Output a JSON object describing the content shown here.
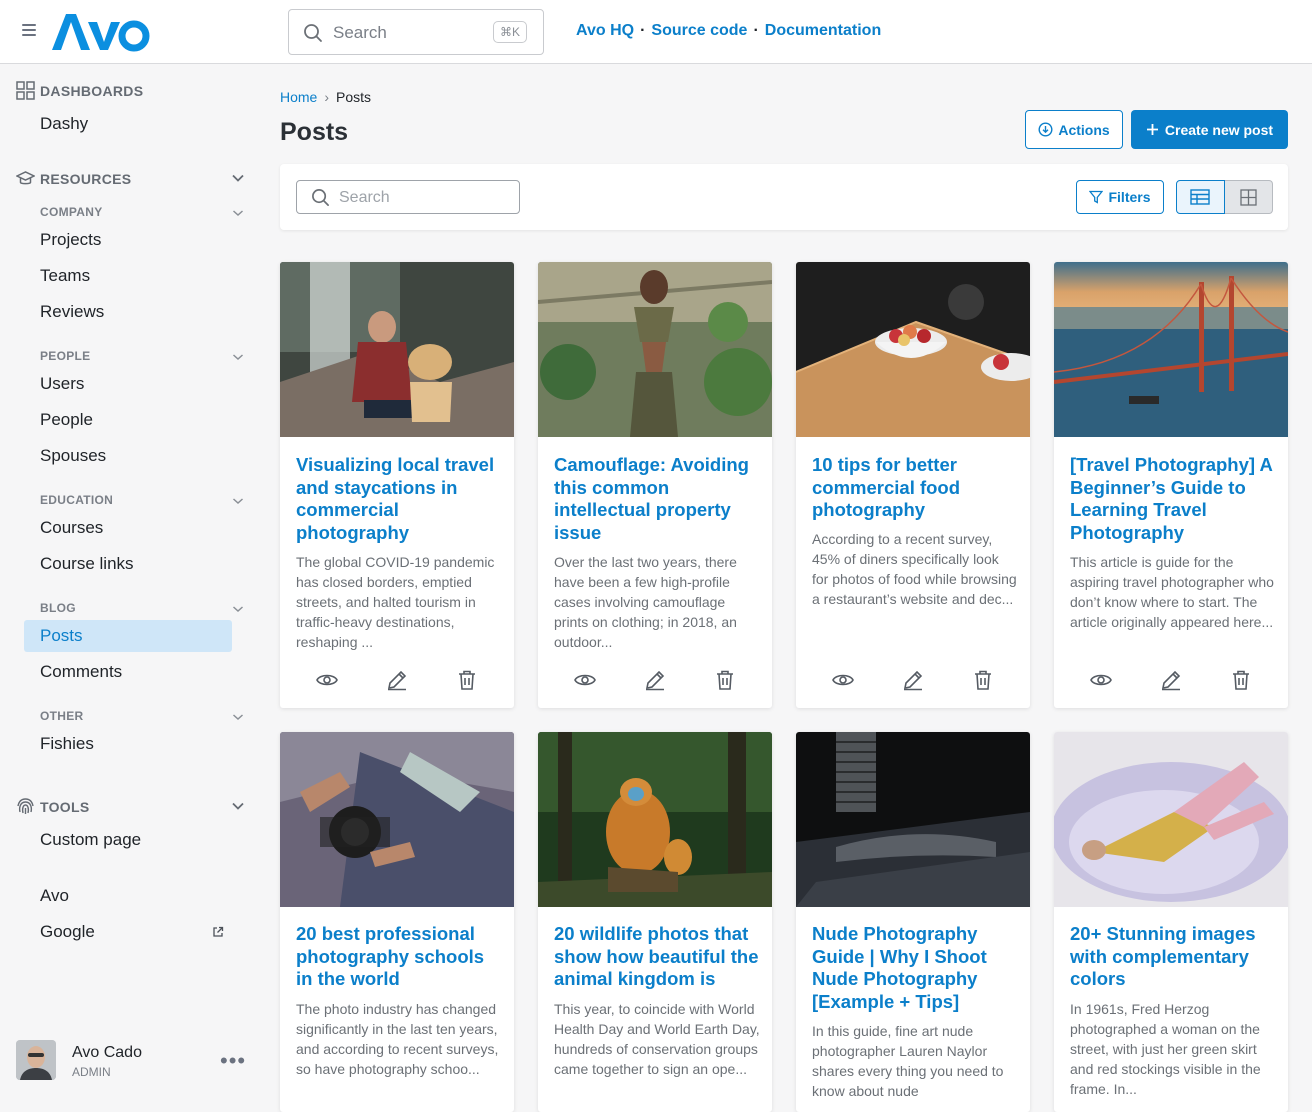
{
  "app": {
    "brand": "Avo"
  },
  "top": {
    "search_placeholder": "Search",
    "shortcut": "⌘K",
    "links": [
      "Avo HQ",
      "Source code",
      "Documentation"
    ]
  },
  "sidebar": {
    "dashboards": {
      "heading": "DASHBOARDS",
      "items": [
        "Dashy"
      ]
    },
    "resources": {
      "heading": "RESOURCES",
      "groups": [
        {
          "name": "COMPANY",
          "items": [
            "Projects",
            "Teams",
            "Reviews"
          ]
        },
        {
          "name": "PEOPLE",
          "items": [
            "Users",
            "People",
            "Spouses"
          ]
        },
        {
          "name": "EDUCATION",
          "items": [
            "Courses",
            "Course links"
          ]
        },
        {
          "name": "BLOG",
          "items": [
            "Posts",
            "Comments"
          ]
        },
        {
          "name": "OTHER",
          "items": [
            "Fishies"
          ]
        }
      ]
    },
    "tools": {
      "heading": "TOOLS",
      "items": [
        "Custom page"
      ]
    },
    "links": [
      "Avo",
      "Google"
    ],
    "active": "Posts",
    "user": {
      "name": "Avo Cado",
      "role": "ADMIN"
    }
  },
  "main": {
    "breadcrumb": {
      "home": "Home",
      "current": "Posts"
    },
    "title": "Posts",
    "actions_label": "Actions",
    "create_label": "Create new post",
    "search_placeholder": "Search",
    "filters_label": "Filters",
    "view_mode": "table",
    "posts": [
      {
        "title": "Visualizing local travel and staycations in commercial photography",
        "excerpt": "The global COVID-19 pandemic has closed borders, emptied streets, and halted tourism in traffic-heavy destinations, reshaping ..."
      },
      {
        "title": "Camouflage: Avoiding this common intellectual property issue",
        "excerpt": "Over the last two years, there have been a few high-profile cases involving camouflage prints on clothing; in 2018, an outdoor..."
      },
      {
        "title": "10 tips for better commercial food photography",
        "excerpt": "According to a recent survey, 45% of diners specifically look for photos of food while browsing a restaurant’s website and dec..."
      },
      {
        "title": "[Travel Photography] A Beginner’s Guide to Learning Travel Photography",
        "excerpt": "This article is guide for the aspiring travel photographer who don’t know where to start. The article originally appeared here..."
      },
      {
        "title": "20 best professional photography schools in the world",
        "excerpt": "The photo industry has changed significantly in the last ten years, and according to recent surveys, so have photography schoo..."
      },
      {
        "title": "20 wildlife photos that show how beautiful the animal kingdom is",
        "excerpt": "This year, to coincide with World Health Day and World Earth Day, hundreds of conservation groups came together to sign an ope..."
      },
      {
        "title": "Nude Photography Guide | Why I Shoot Nude Photography [Example + Tips]",
        "excerpt": "In this guide, fine art nude photographer Lauren Naylor shares every thing you need to know about nude"
      },
      {
        "title": "20+ Stunning images with complementary colors",
        "excerpt": "In 1961s, Fred Herzog photographed a woman on the street, with just her green skirt and red stockings visible in the frame. In..."
      }
    ]
  },
  "colors": {
    "accent": "#0b7fca",
    "active_bg": "#cfe6f8"
  }
}
